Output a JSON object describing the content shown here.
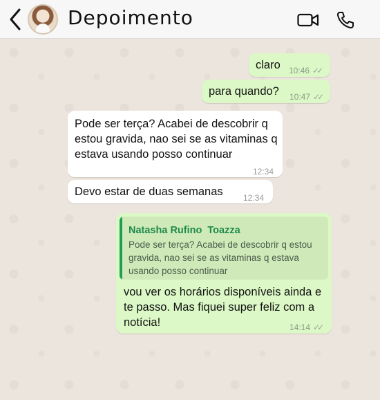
{
  "header": {
    "title": "Depoimento",
    "back_icon": "chevron-left-icon",
    "video_icon": "video-camera-icon",
    "phone_icon": "phone-icon"
  },
  "messages": [
    {
      "direction": "outgoing",
      "text": "claro",
      "time": "10:46",
      "status": "read"
    },
    {
      "direction": "outgoing",
      "text": "para quando?",
      "time": "10:47",
      "status": "read"
    },
    {
      "direction": "incoming",
      "text": "Pode ser terça? Acabei de descobrir q estou gravida, nao sei se as vitaminas q estava usando posso continuar",
      "time": "12:34"
    },
    {
      "direction": "incoming",
      "text": "Devo estar de duas semanas",
      "time": "12:34"
    },
    {
      "direction": "outgoing",
      "quote": {
        "author": "Natasha Rufino  Toazza",
        "text": "Pode ser terça? Acabei de descobrir q estou gravida, nao sei se as vitaminas q estava usando posso continuar"
      },
      "text": "vou ver os horários disponíveis ainda e te passo. Mas fiquei super feliz com a notícia!",
      "time": "14:14",
      "status": "read"
    }
  ],
  "colors": {
    "outgoing": "#dcf8c6",
    "incoming": "#ffffff",
    "quote_accent": "#1f9d55",
    "chat_bg": "#ece5dd"
  }
}
